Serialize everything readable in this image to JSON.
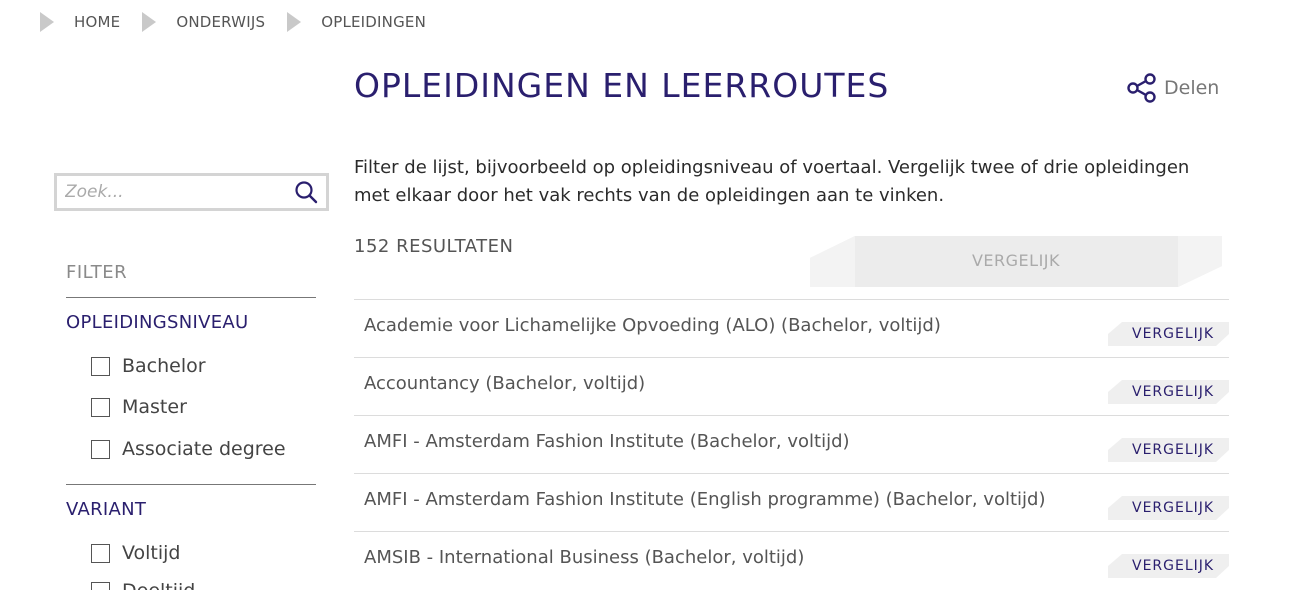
{
  "breadcrumb": [
    "HOME",
    "ONDERWIJS",
    "OPLEIDINGEN"
  ],
  "title": "OPLEIDINGEN EN LEERROUTES",
  "share_label": "Delen",
  "intro": "Filter de lijst, bijvoorbeeld op opleidingsniveau of voertaal. Vergelijk twee of drie opleidingen met elkaar door het vak rechts van de opleidingen aan te vinken.",
  "search": {
    "placeholder": "Zoek..."
  },
  "filter": {
    "title": "FILTER",
    "groups": [
      {
        "title": "OPLEIDINGSNIVEAU",
        "options": [
          "Bachelor",
          "Master",
          "Associate degree"
        ]
      },
      {
        "title": "VARIANT",
        "options": [
          "Voltijd",
          "Deeltijd"
        ]
      }
    ]
  },
  "results": {
    "count_label": "152 RESULTATEN",
    "compare_label": "VERGELIJK",
    "item_compare_label": "VERGELIJK",
    "items": [
      "Academie voor Lichamelijke Opvoeding (ALO) (Bachelor, voltijd)",
      "Accountancy (Bachelor, voltijd)",
      "AMFI - Amsterdam Fashion Institute (Bachelor, voltijd)",
      "AMFI - Amsterdam Fashion Institute (English programme) (Bachelor, voltijd)",
      "AMSIB - International Business (Bachelor, voltijd)"
    ]
  },
  "colors": {
    "accent": "#2a1f6e",
    "muted": "#8a8a8a",
    "button_bg": "#ececec"
  }
}
